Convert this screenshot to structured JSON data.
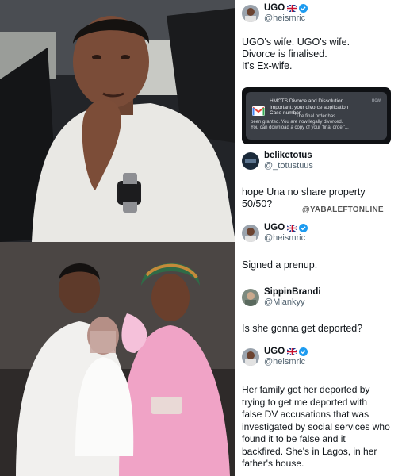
{
  "watermark": "@YABALEFTONLINE",
  "colors": {
    "verified": "#1d9bf0",
    "handle": "#536471",
    "notification_bg": "#3b3f46"
  },
  "tweets": [
    {
      "name": "UGO",
      "flag": "uk-flag",
      "verified": true,
      "handle": "@heismric",
      "lines": [
        "UGO's wife. UGO's wife.",
        "Divorce is finalised.",
        "It's Ex-wife."
      ]
    },
    {
      "name": "beliketotus",
      "verified": false,
      "handle": "@_totustuus",
      "lines": [
        "hope Una no share property",
        "50/50?"
      ]
    },
    {
      "name": "UGO",
      "flag": "uk-flag",
      "verified": true,
      "handle": "@heismric",
      "lines": [
        "Signed a prenup."
      ]
    },
    {
      "name": "SippinBrandi",
      "verified": false,
      "handle": "@Miankyy",
      "lines": [
        "Is she gonna get deported?"
      ]
    },
    {
      "name": "UGO",
      "flag": "uk-flag",
      "verified": true,
      "handle": "@heismric",
      "lines": [
        "Her family got her deported by",
        "trying to get me deported with",
        "false DV accusations that was",
        "investigated by social services who",
        "found it to be false and it",
        "backfired. She's in Lagos, in her",
        "father's house."
      ]
    }
  ],
  "notification": {
    "app_icon": "gmail-icon",
    "title": "HMCTS Divorce and Dissolution",
    "subtitle": "Important: your divorce application",
    "case": "Case number",
    "time": "now",
    "body": [
      "'The final order has",
      "been granted. You are now legally divorced.",
      "You can download a copy of your 'final order'..."
    ]
  }
}
